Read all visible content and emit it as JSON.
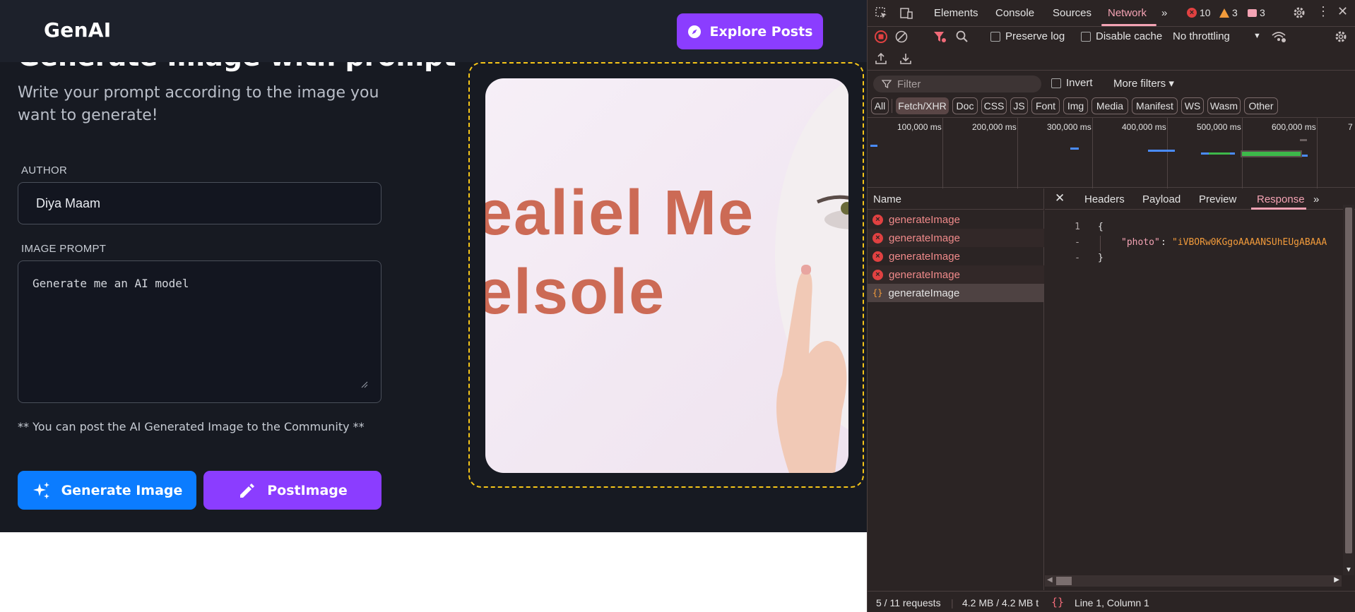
{
  "app": {
    "brand": "GenAI",
    "explore_label": "Explore Posts",
    "title": "Generate Image with prompt",
    "subtitle": "Write your prompt according to the image you want to generate!",
    "author_label": "AUTHOR",
    "author_value": "Diya Maam",
    "prompt_label": "IMAGE PROMPT",
    "prompt_value": "Generate me an AI model",
    "helper": "** You can post the AI Generated Image to the Community **",
    "generate_label": "Generate Image",
    "post_label": "PostImage",
    "preview_text_1": "ealiel Me",
    "preview_text_2": "elsole",
    "colors": {
      "accent_purple": "#8b3dff",
      "accent_blue": "#0b7cff",
      "frame_yellow": "#f5c518"
    }
  },
  "devtools": {
    "tabs": [
      "Elements",
      "Console",
      "Sources",
      "Network"
    ],
    "active_tab": "Network",
    "errors": "10",
    "warnings": "3",
    "messages": "3",
    "preserve_log": "Preserve log",
    "disable_cache": "Disable cache",
    "throttling": "No throttling",
    "filter_placeholder": "Filter",
    "invert": "Invert",
    "more_filters": "More filters",
    "type_filters": [
      "All",
      "Fetch/XHR",
      "Doc",
      "CSS",
      "JS",
      "Font",
      "Img",
      "Media",
      "Manifest",
      "WS",
      "Wasm",
      "Other"
    ],
    "active_type": "Fetch/XHR",
    "timeline_labels": [
      "100,000 ms",
      "200,000 ms",
      "300,000 ms",
      "400,000 ms",
      "500,000 ms",
      "600,000 ms",
      "7"
    ],
    "name_header": "Name",
    "requests": [
      {
        "name": "generateImage",
        "status": "error"
      },
      {
        "name": "generateImage",
        "status": "error"
      },
      {
        "name": "generateImage",
        "status": "error"
      },
      {
        "name": "generateImage",
        "status": "error"
      },
      {
        "name": "generateImage",
        "status": "json"
      }
    ],
    "detail_tabs": [
      "Headers",
      "Payload",
      "Preview",
      "Response"
    ],
    "active_detail_tab": "Response",
    "response": {
      "line1_num": "1",
      "line1": "{",
      "line2_num": "-",
      "line2_key": "\"photo\"",
      "line2_value": "\"iVBORw0KGgoAAAANSUhEUgABAAA",
      "line3_num": "-",
      "line3": "}"
    },
    "status_requests": "5 / 11 requests",
    "status_size": "4.2 MB / 4.2 MB t",
    "status_cursor": "Line 1, Column 1"
  }
}
